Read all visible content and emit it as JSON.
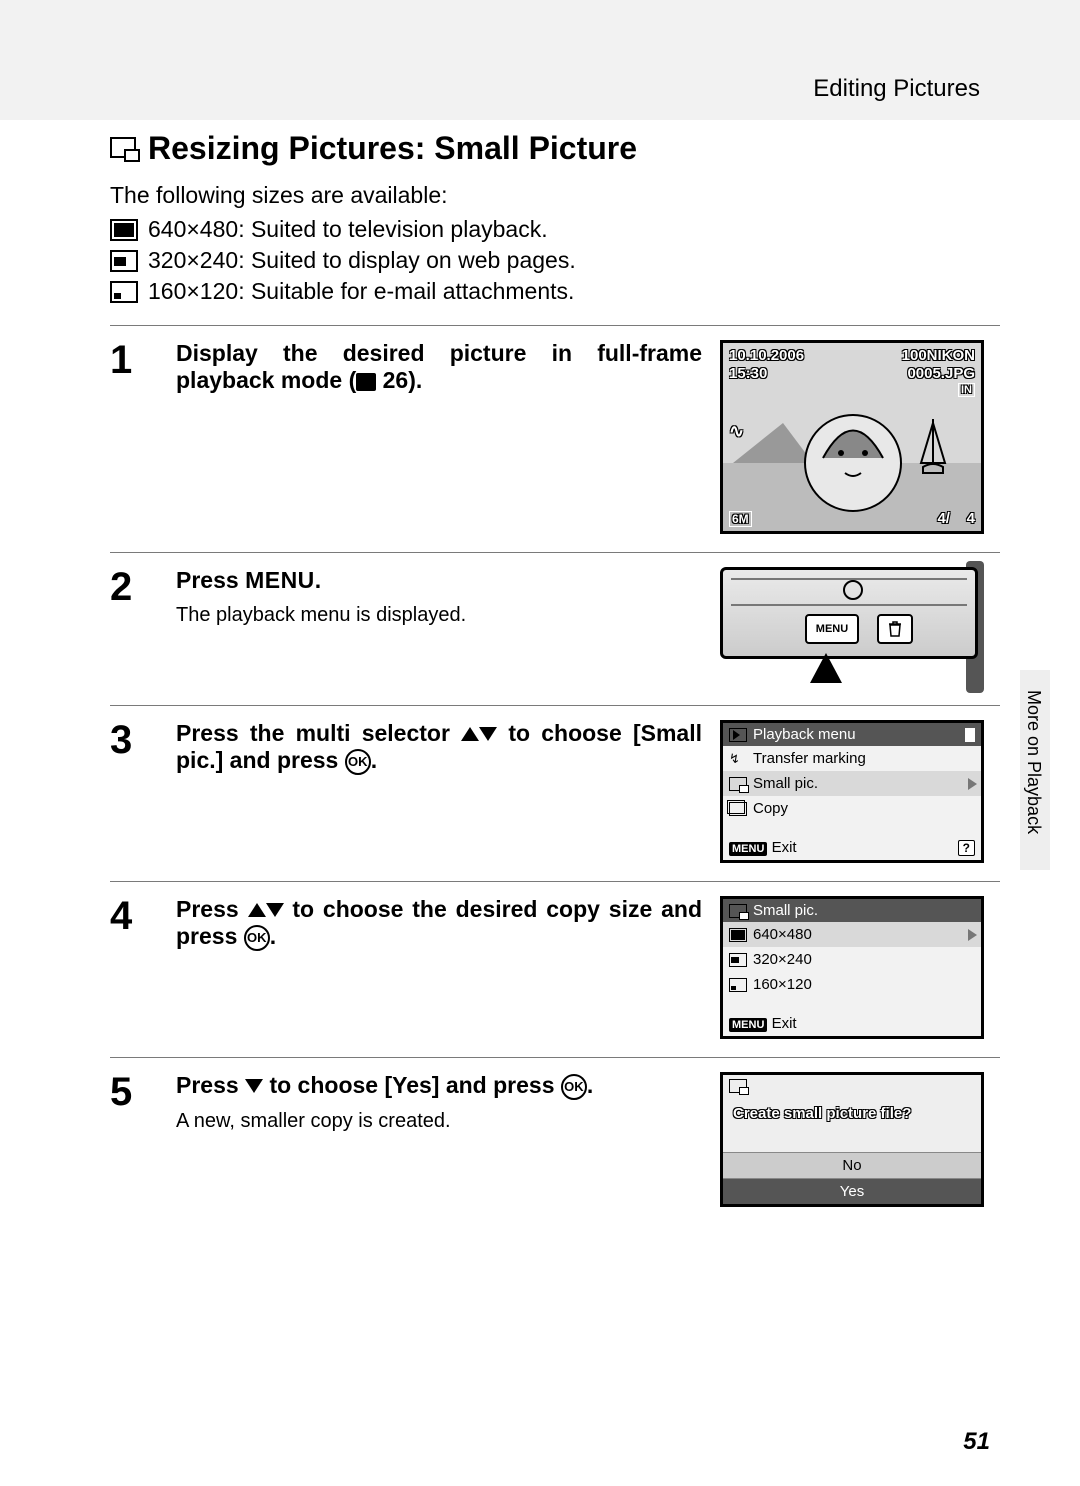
{
  "header": {
    "section": "Editing Pictures"
  },
  "title": "Resizing Pictures: Small Picture",
  "intro": "The following sizes are available:",
  "sizes": [
    {
      "dim": "640×480",
      "desc": "Suited to television playback."
    },
    {
      "dim": "320×240",
      "desc": "Suited to display on web pages."
    },
    {
      "dim": "160×120",
      "desc": "Suitable for e-mail attachments."
    }
  ],
  "steps": {
    "s1": {
      "num": "1",
      "head_a": "Display the desired picture in full-frame playback mode (",
      "head_b": " 26).",
      "shot": {
        "date": "10.10.2006",
        "time": "15:30",
        "folder": "100NIKON",
        "file": "0005.JPG",
        "mem": "IN",
        "quality": "6M",
        "counter": "4/    4"
      }
    },
    "s2": {
      "num": "2",
      "head_a": "Press ",
      "head_b": "MENU",
      "head_c": ".",
      "sub": "The playback menu is displayed.",
      "btn_menu": "MENU"
    },
    "s3": {
      "num": "3",
      "head_a": "Press the multi selector ",
      "head_b": " to choose [Small pic.] and press ",
      "ok": "OK",
      "head_c": ".",
      "menu": {
        "title": "Playback menu",
        "items": [
          "Transfer marking",
          "Small pic.",
          "Copy"
        ],
        "exit_chip": "MENU",
        "exit": "Exit",
        "help": "?"
      }
    },
    "s4": {
      "num": "4",
      "head_a": "Press ",
      "head_b": " to choose the desired copy size and press ",
      "ok": "OK",
      "head_c": ".",
      "menu": {
        "title": "Small pic.",
        "items": [
          "640×480",
          "320×240",
          "160×120"
        ],
        "exit_chip": "MENU",
        "exit": "Exit"
      }
    },
    "s5": {
      "num": "5",
      "head_a": "Press ",
      "head_b": " to choose [Yes] and press ",
      "ok": "OK",
      "head_c": ".",
      "sub": "A new, smaller copy is created.",
      "dlg": {
        "question": "Create small picture file?",
        "no": "No",
        "yes": "Yes"
      }
    }
  },
  "side_tab": "More on Playback",
  "page_number": "51"
}
